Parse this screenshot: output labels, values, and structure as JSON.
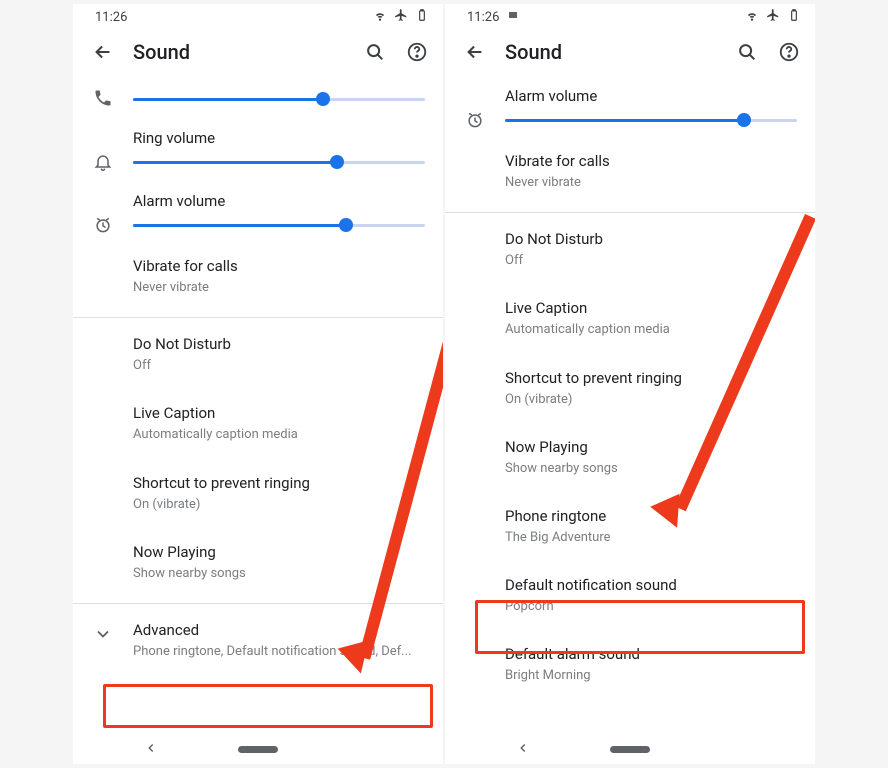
{
  "left": {
    "time": "11:26",
    "title": "Sound",
    "ring_label": "Ring volume",
    "ring_value": 70,
    "alarm_label": "Alarm volume",
    "alarm_value": 73,
    "call_value": 65,
    "vibrate_title": "Vibrate for calls",
    "vibrate_sub": "Never vibrate",
    "dnd_title": "Do Not Disturb",
    "dnd_sub": "Off",
    "live_title": "Live Caption",
    "live_sub": "Automatically caption media",
    "shortcut_title": "Shortcut to prevent ringing",
    "shortcut_sub": "On (vibrate)",
    "nowplaying_title": "Now Playing",
    "nowplaying_sub": "Show nearby songs",
    "advanced_title": "Advanced",
    "advanced_sub": "Phone ringtone, Default notification sound, Def..."
  },
  "right": {
    "time": "11:26",
    "title": "Sound",
    "alarm_label": "Alarm volume",
    "alarm_value": 82,
    "vibrate_title": "Vibrate for calls",
    "vibrate_sub": "Never vibrate",
    "dnd_title": "Do Not Disturb",
    "dnd_sub": "Off",
    "live_title": "Live Caption",
    "live_sub": "Automatically caption media",
    "shortcut_title": "Shortcut to prevent ringing",
    "shortcut_sub": "On (vibrate)",
    "nowplaying_title": "Now Playing",
    "nowplaying_sub": "Show nearby songs",
    "ringtone_title": "Phone ringtone",
    "ringtone_sub": "The Big Adventure",
    "notif_title": "Default notification sound",
    "notif_sub": "Popcorn",
    "alarmsound_title": "Default alarm sound",
    "alarmsound_sub": "Bright Morning"
  },
  "colors": {
    "accent": "#1a73e8",
    "highlight": "#ED3A1C"
  }
}
